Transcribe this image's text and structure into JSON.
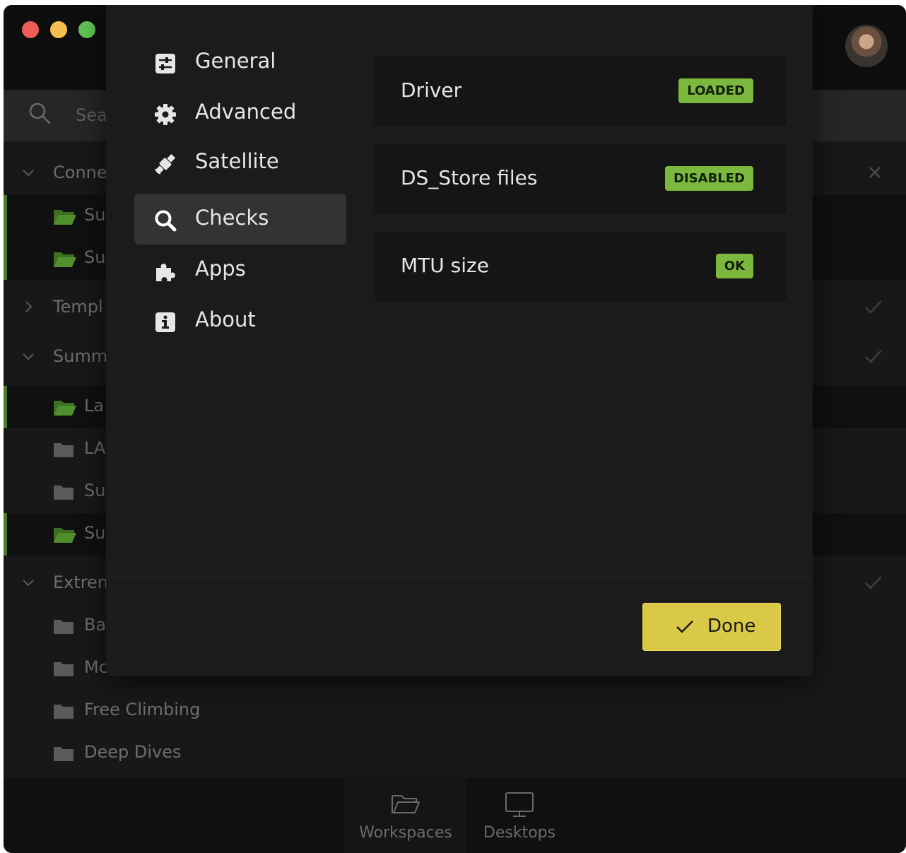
{
  "search": {
    "placeholder": "Sea"
  },
  "list": {
    "groups": [
      {
        "label": "Conne"
      },
      {
        "label": "Templ"
      },
      {
        "label": "Summ"
      },
      {
        "label": "Extren"
      }
    ],
    "items": [
      {
        "label": "Su"
      },
      {
        "label": "Su"
      },
      {
        "label": "La"
      },
      {
        "label": "LA"
      },
      {
        "label": "Su"
      },
      {
        "label": "Su"
      },
      {
        "label": "Ba"
      },
      {
        "label": "Mc"
      },
      {
        "label": "Free Climbing"
      },
      {
        "label": "Deep Dives"
      }
    ]
  },
  "bottom_nav": {
    "workspaces": "Workspaces",
    "desktops": "Desktops"
  },
  "settings_nav": [
    {
      "label": "General",
      "icon": "sliders-icon"
    },
    {
      "label": "Advanced",
      "icon": "gear-icon"
    },
    {
      "label": "Satellite",
      "icon": "satellite-icon"
    },
    {
      "label": "Checks",
      "icon": "search-icon",
      "active": true
    },
    {
      "label": "Apps",
      "icon": "puzzle-icon"
    },
    {
      "label": "About",
      "icon": "info-icon"
    }
  ],
  "checks": [
    {
      "label": "Driver",
      "status": "LOADED"
    },
    {
      "label": "DS_Store files",
      "status": "DISABLED"
    },
    {
      "label": "MTU size",
      "status": "OK"
    }
  ],
  "done_label": "Done",
  "colors": {
    "accent_green": "#7cb83e",
    "done_yellow": "#dac947",
    "close_red": "#ed5c57",
    "minimize_yellow": "#f5bf4f",
    "zoom_green": "#61c454",
    "folder_green": "#4f8f2c"
  }
}
